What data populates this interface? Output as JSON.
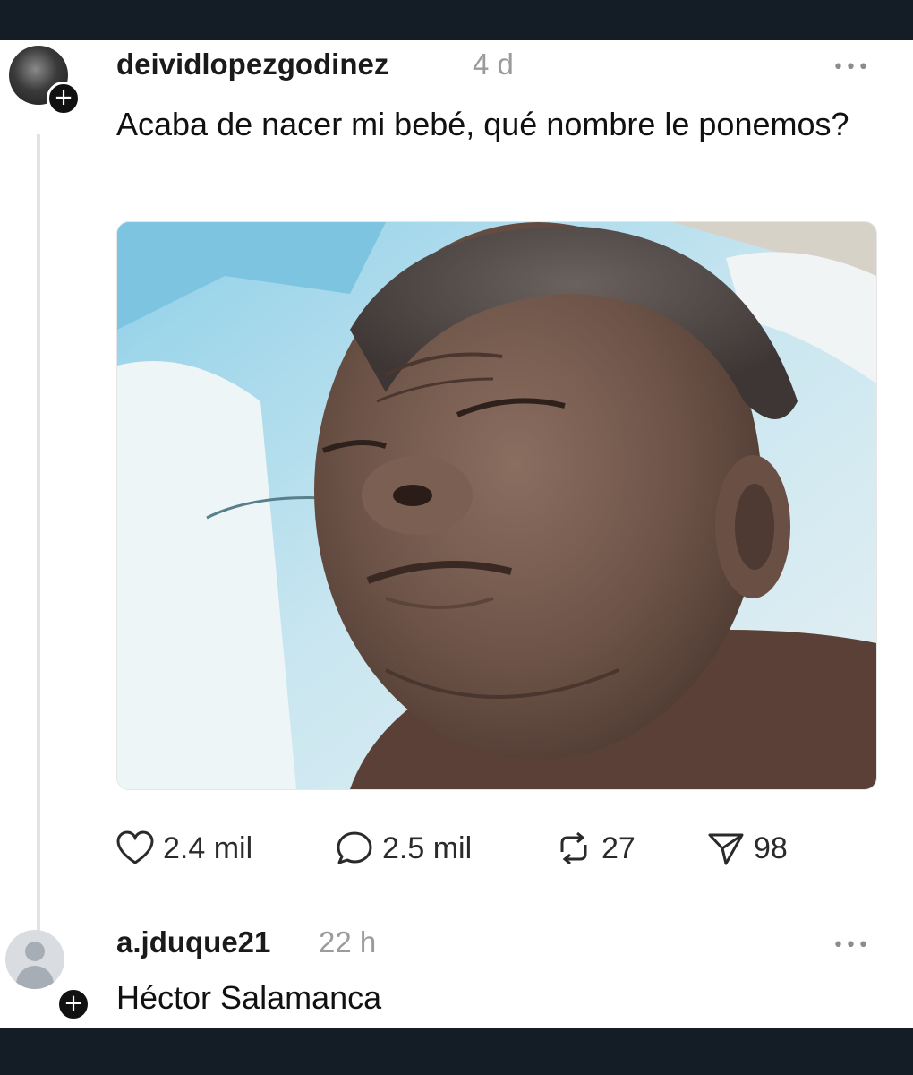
{
  "post": {
    "username": "deividlopezgodinez",
    "time": "4 d",
    "text": "Acaba de nacer mi bebé, qué nombre le ponemos?",
    "more_label": "•••",
    "follow_label": "+",
    "avatar_icon": "user-photo-avatar",
    "photo": "crying-newborn-baby-on-blue-blanket",
    "actions": {
      "likes": "2.4 mil",
      "replies": "2.5 mil",
      "reposts": "27",
      "shares": "98"
    },
    "icons": {
      "like": "heart-icon",
      "reply": "speech-bubble-icon",
      "repost": "repost-arrows-icon",
      "share": "paper-plane-icon"
    }
  },
  "reply": {
    "username": "a.jduque21",
    "time": "22 h",
    "text": "Héctor Salamanca",
    "more_label": "•••",
    "follow_label": "+",
    "avatar_icon": "default-user-avatar"
  },
  "colors": {
    "frame": "#141c26",
    "background": "#ffffff",
    "text": "#111111",
    "muted": "#9b9b9b",
    "thread_line": "#e2e2e2"
  }
}
